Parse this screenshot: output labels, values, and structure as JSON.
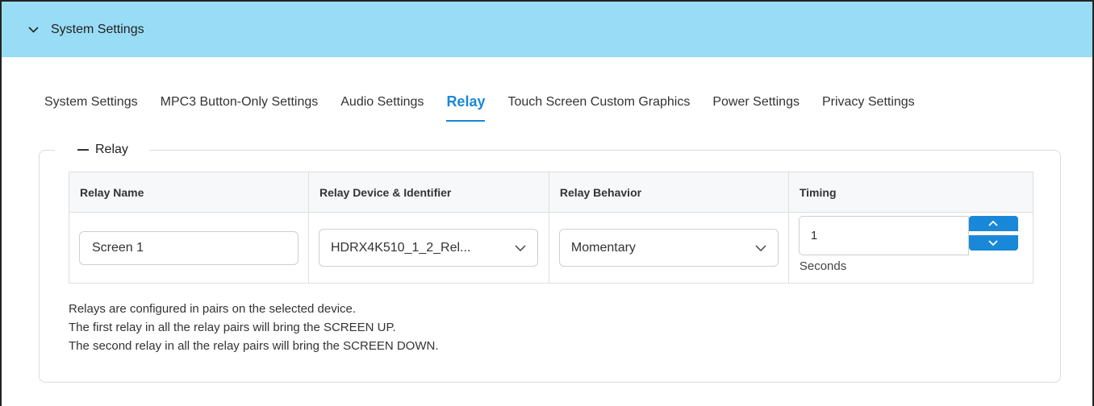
{
  "header": {
    "title": "System Settings",
    "collapse_icon": "chevron-down-icon"
  },
  "tabs": [
    {
      "label": "System Settings",
      "active": false
    },
    {
      "label": "MPC3 Button-Only Settings",
      "active": false
    },
    {
      "label": "Audio Settings",
      "active": false
    },
    {
      "label": "Relay",
      "active": true
    },
    {
      "label": "Touch Screen Custom Graphics",
      "active": false
    },
    {
      "label": "Power Settings",
      "active": false
    },
    {
      "label": "Privacy Settings",
      "active": false
    }
  ],
  "section": {
    "legend": "Relay"
  },
  "table": {
    "headers": [
      "Relay Name",
      "Relay Device & Identifier",
      "Relay Behavior",
      "Timing"
    ],
    "row": {
      "name": "Screen 1",
      "device": "HDRX4K510_1_2_Rel...",
      "behavior": "Momentary",
      "timing_value": "1",
      "timing_unit": "Seconds"
    }
  },
  "notes": [
    "Relays are configured in pairs on the selected device.",
    "The first relay in all the relay pairs will bring the SCREEN UP.",
    "The second relay in all the relay pairs will bring the SCREEN DOWN."
  ],
  "colors": {
    "header_bg": "#99dcf6",
    "accent": "#1a88d8"
  }
}
